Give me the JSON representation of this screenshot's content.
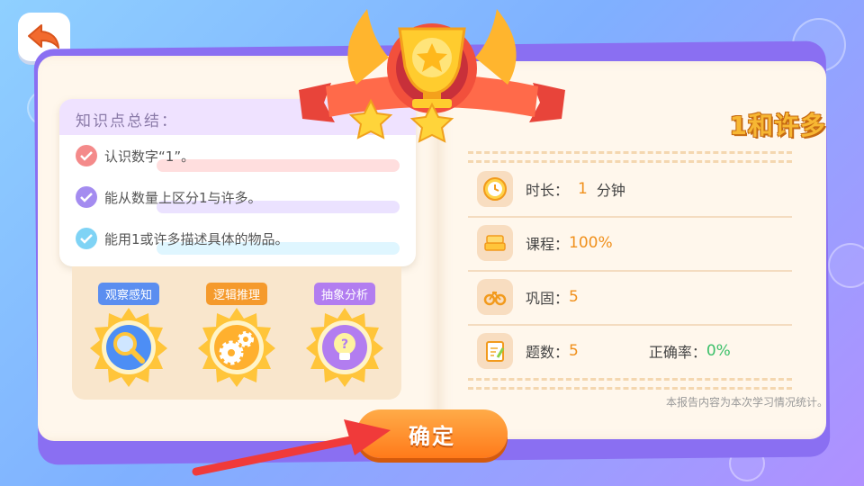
{
  "summary": {
    "heading": "知识点总结：",
    "items": [
      {
        "text": "认识数字“1”。",
        "check_color": "#f48a8a",
        "highlight": "#ffdede"
      },
      {
        "text": "能从数量上区分1与许多。",
        "check_color": "#a48cf0",
        "highlight": "#ebe2ff"
      },
      {
        "text": "能用1或许多描述具体的物品。",
        "check_color": "#7fd3f5",
        "highlight": "#dff6ff"
      }
    ]
  },
  "badges": [
    {
      "label": "观察感知",
      "icon": "magnifier-icon",
      "tag_color": "#5b8ef0"
    },
    {
      "label": "逻辑推理",
      "icon": "gears-icon",
      "tag_color": "#f59a2c"
    },
    {
      "label": "抽象分析",
      "icon": "lightbulb-icon",
      "tag_color": "#b27df0"
    }
  ],
  "lesson": {
    "title": "1和许多",
    "duration_label": "时长：",
    "duration_value": "1",
    "duration_unit": "分钟",
    "course_label": "课程：",
    "course_value": "100%",
    "consolidate_label": "巩固：",
    "consolidate_value": "5",
    "questions_label": "题数：",
    "questions_value": "5",
    "accuracy_label": "正确率：",
    "accuracy_value": "0%",
    "note": "本报告内容为本次学习情况统计。"
  },
  "confirm_label": "确定",
  "colors": {
    "accent_orange": "#f0901c",
    "accuracy_green": "#3cc06a",
    "book_purple": "#8a6ff2"
  },
  "icons": [
    "back-arrow-icon",
    "trophy-icon",
    "clock-icon",
    "books-icon",
    "bike-icon",
    "notepad-icon",
    "pointer-arrow-icon"
  ]
}
